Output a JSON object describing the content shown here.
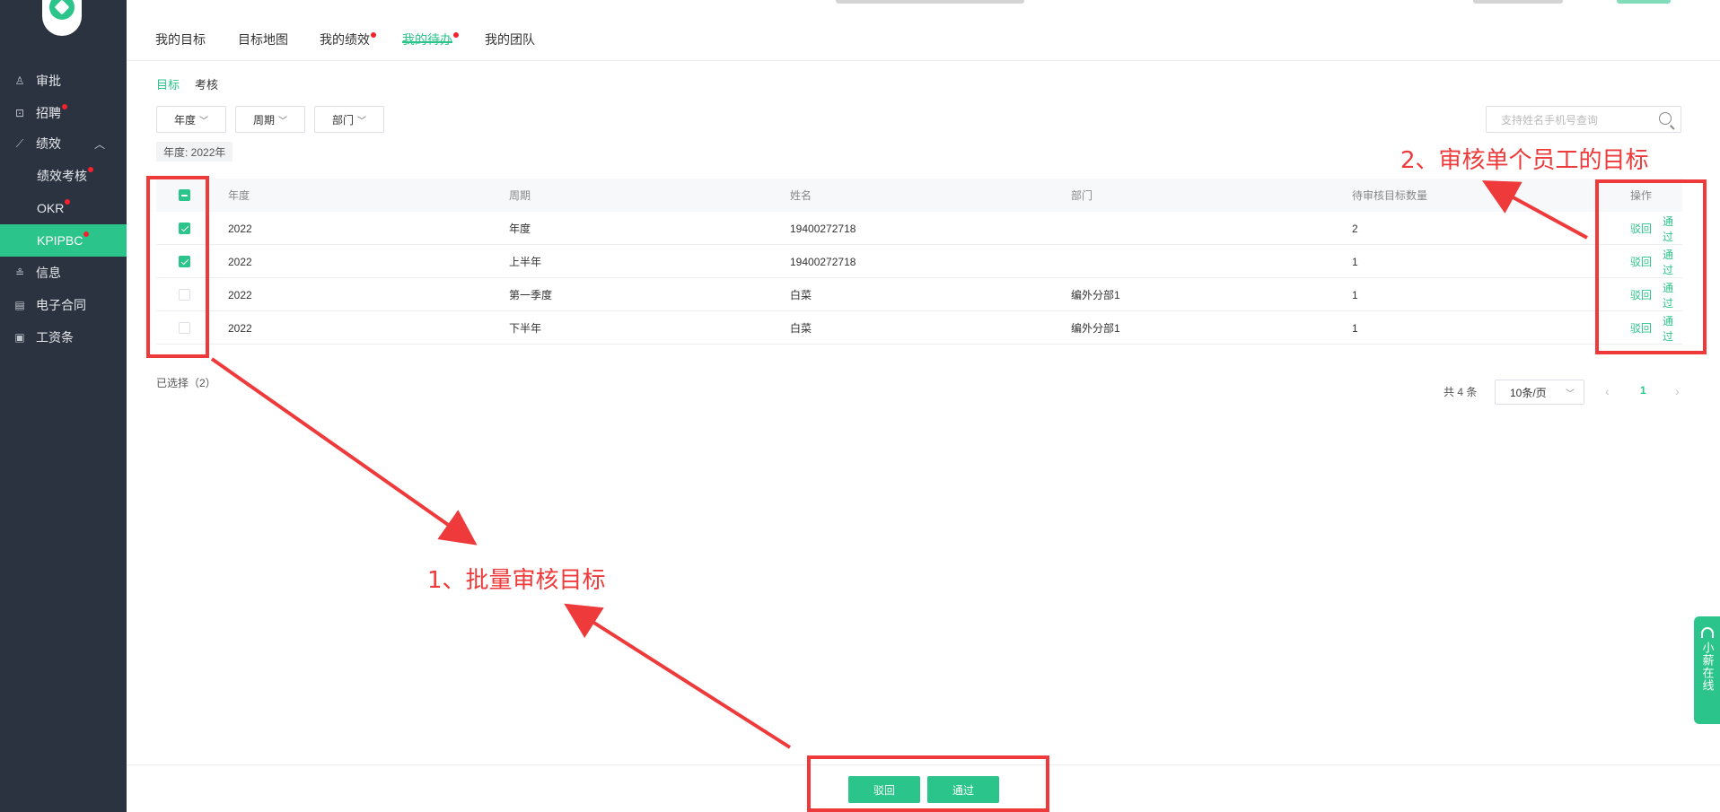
{
  "sidebar": {
    "items": [
      {
        "label": "审批",
        "icon": "stamp-icon",
        "dot": false
      },
      {
        "label": "招聘",
        "icon": "recruit-icon",
        "dot": true
      },
      {
        "label": "绩效",
        "icon": "chart-line-icon",
        "dot": false,
        "expanded": true
      },
      {
        "label": "信息",
        "icon": "user-info-icon",
        "dot": false
      },
      {
        "label": "电子合同",
        "icon": "contract-icon",
        "dot": false
      },
      {
        "label": "工资条",
        "icon": "payslip-icon",
        "dot": false
      }
    ],
    "sub_items": [
      {
        "label": "绩效考核",
        "dot": true,
        "active": false
      },
      {
        "label": "OKR",
        "dot": true,
        "active": false
      },
      {
        "label": "KPIPBC",
        "dot": true,
        "active": true
      }
    ]
  },
  "tabs": [
    {
      "label": "我的目标",
      "dot": false
    },
    {
      "label": "目标地图",
      "dot": false
    },
    {
      "label": "我的绩效",
      "dot": true
    },
    {
      "label": "我的待办",
      "dot": true,
      "active": true
    },
    {
      "label": "我的团队",
      "dot": false
    }
  ],
  "subtabs": [
    {
      "label": "目标",
      "active": true
    },
    {
      "label": "考核",
      "active": false
    }
  ],
  "filters": [
    "年度",
    "周期",
    "部门"
  ],
  "active_tag": "年度: 2022年",
  "search": {
    "placeholder": "支持姓名手机号查询"
  },
  "table": {
    "columns": [
      "年度",
      "周期",
      "姓名",
      "部门",
      "待审核目标数量",
      "操作"
    ],
    "rows": [
      {
        "checked": true,
        "year": "2022",
        "period": "年度",
        "name": "19400272718",
        "dept": "",
        "count": "2"
      },
      {
        "checked": true,
        "year": "2022",
        "period": "上半年",
        "name": "19400272718",
        "dept": "",
        "count": "1"
      },
      {
        "checked": false,
        "year": "2022",
        "period": "第一季度",
        "name": "白菜",
        "dept": "编外分部1",
        "count": "1"
      },
      {
        "checked": false,
        "year": "2022",
        "period": "下半年",
        "name": "白菜",
        "dept": "编外分部1",
        "count": "1"
      }
    ],
    "actions": {
      "reject": "驳回",
      "approve": "通过"
    }
  },
  "selected_text": "已选择（2）",
  "pagination": {
    "total": "共 4 条",
    "page_size": "10条/页",
    "current_page": "1"
  },
  "bottom_actions": {
    "reject": "驳回",
    "approve": "通过"
  },
  "chat_widget": "小薪在线",
  "annotations": {
    "batch": "1、批量审核目标",
    "single": "2、审核单个员工的目标"
  },
  "colors": {
    "accent": "#2bc48a",
    "sidebar_bg": "#2b3340",
    "annotation": "#ee3a3a"
  }
}
